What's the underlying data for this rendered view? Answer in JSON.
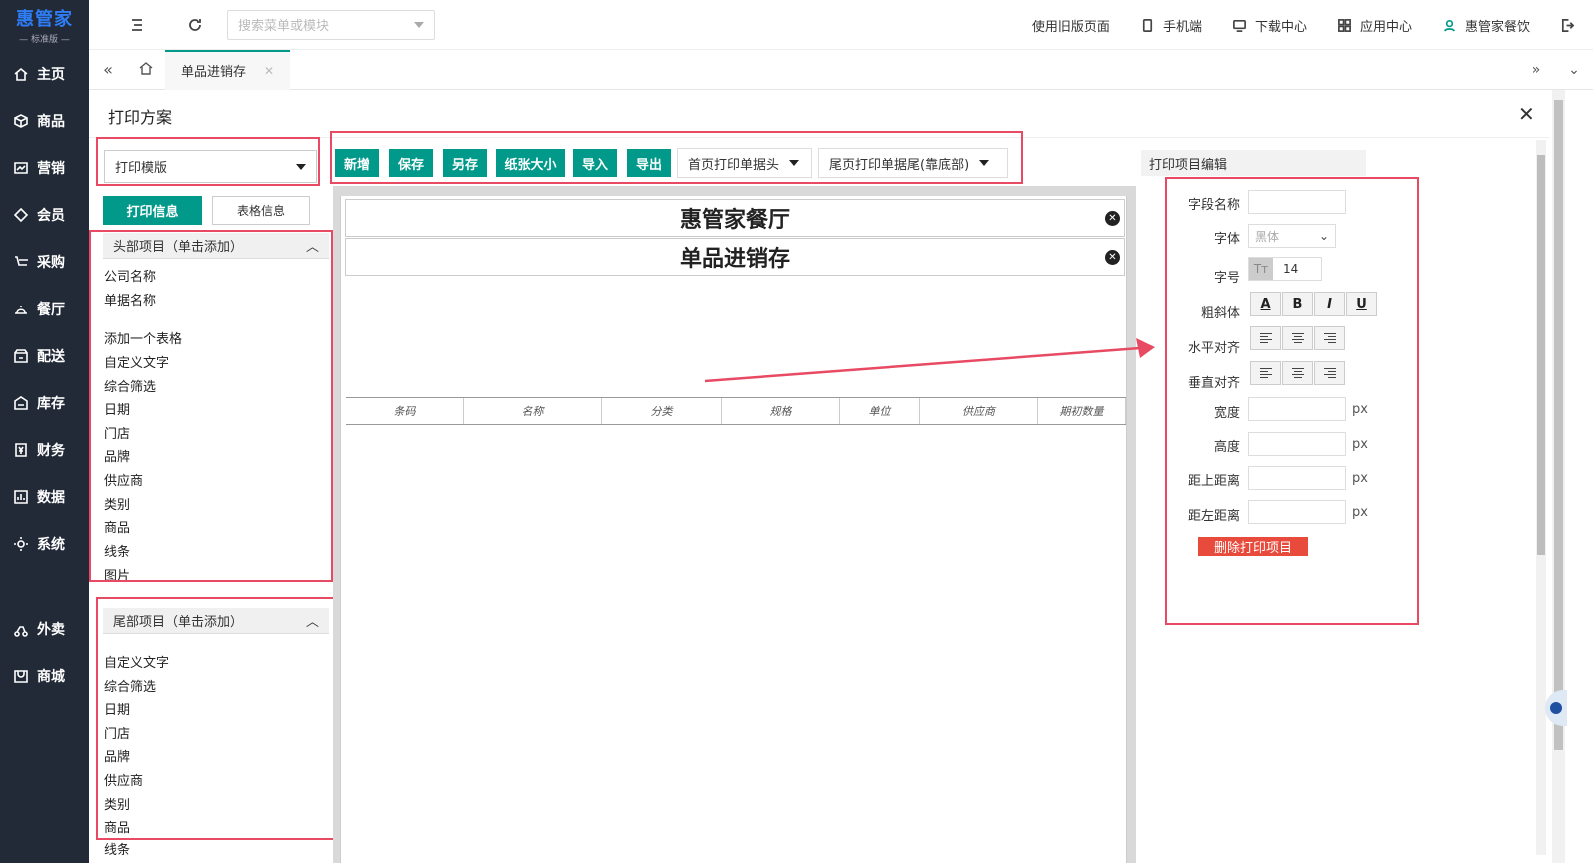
{
  "brand": {
    "name": "惠管家",
    "edition": "— 标准版 —"
  },
  "sidebar": {
    "items": [
      {
        "label": "主页",
        "icon": "home-icon"
      },
      {
        "label": "商品",
        "icon": "box-icon"
      },
      {
        "label": "营销",
        "icon": "chart-icon"
      },
      {
        "label": "会员",
        "icon": "diamond-icon"
      },
      {
        "label": "采购",
        "icon": "cart-icon"
      },
      {
        "label": "餐厅",
        "icon": "bell-icon"
      },
      {
        "label": "配送",
        "icon": "store-icon"
      },
      {
        "label": "库存",
        "icon": "warehouse-icon"
      },
      {
        "label": "财务",
        "icon": "yuan-icon"
      },
      {
        "label": "数据",
        "icon": "bar-chart-icon"
      },
      {
        "label": "系统",
        "icon": "settings-icon"
      },
      {
        "label": "外卖",
        "icon": "bike-icon"
      },
      {
        "label": "商城",
        "icon": "mall-icon"
      }
    ]
  },
  "topbar": {
    "search_placeholder": "搜索菜单或模块",
    "links": [
      "使用旧版页面",
      "手机端",
      "下载中心",
      "应用中心",
      "惠管家餐饮"
    ]
  },
  "tabs": {
    "active": "单品进销存"
  },
  "panel": {
    "title": "打印方案"
  },
  "template_select": {
    "value": "打印模版"
  },
  "info_tabs": {
    "print_info": "打印信息",
    "table_info": "表格信息"
  },
  "toolbar": {
    "buttons": [
      "新增",
      "保存",
      "另存",
      "纸张大小",
      "导入",
      "导出"
    ],
    "header_dropdown": "首页打印单据头",
    "footer_dropdown": "尾页打印单据尾(靠底部)"
  },
  "header_section": {
    "title": "头部项目（单击添加）",
    "items": [
      "公司名称",
      "单据名称",
      "添加一个表格",
      "自定义文字",
      "综合筛选",
      "日期",
      "门店",
      "品牌",
      "供应商",
      "类别",
      "商品",
      "线条",
      "图片"
    ]
  },
  "footer_section": {
    "title": "尾部项目（单击添加）",
    "items": [
      "自定义文字",
      "综合筛选",
      "日期",
      "门店",
      "品牌",
      "供应商",
      "类别",
      "商品",
      "线条"
    ]
  },
  "canvas": {
    "company": "惠管家餐厅",
    "doc_title": "单品进销存",
    "columns": [
      "条码",
      "名称",
      "分类",
      "规格",
      "单位",
      "供应商",
      "期初数量"
    ]
  },
  "editor": {
    "title": "打印项目编辑",
    "field_name_label": "字段名称",
    "font_label": "字体",
    "font_value": "黑体",
    "size_label": "字号",
    "size_value": "14",
    "style_label": "粗斜体",
    "style_buttons": [
      "A",
      "B",
      "I",
      "U"
    ],
    "halign_label": "水平对齐",
    "valign_label": "垂直对齐",
    "width_label": "宽度",
    "height_label": "高度",
    "top_label": "距上距离",
    "left_label": "距左距离",
    "unit": "px",
    "delete_button": "删除打印项目"
  },
  "colors": {
    "accent": "#00998a",
    "highlight": "#e84a63",
    "danger": "#e84a3c",
    "sidebar": "#222a38"
  }
}
